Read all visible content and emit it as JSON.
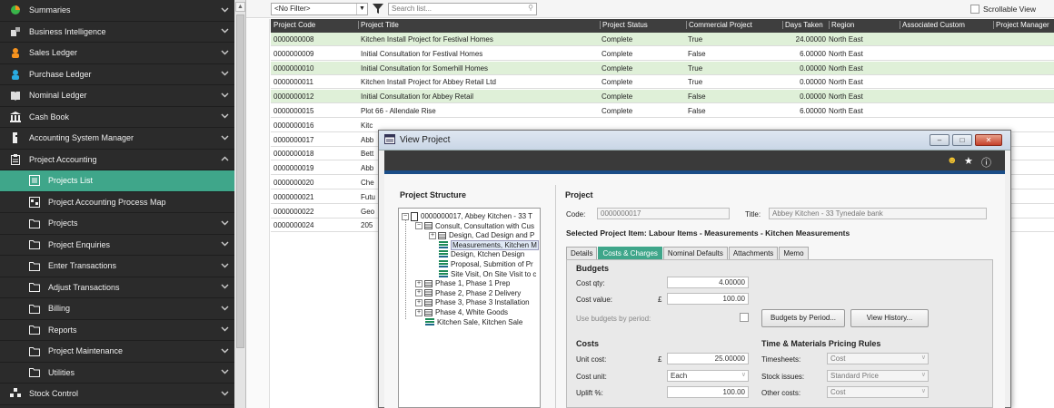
{
  "sidebar": {
    "items": [
      {
        "label": "Summaries",
        "icon": "pie-chart-icon",
        "chev": "down"
      },
      {
        "label": "Business Intelligence",
        "icon": "bi-icon",
        "chev": "down"
      },
      {
        "label": "Sales Ledger",
        "icon": "person-orange-icon",
        "chev": "down"
      },
      {
        "label": "Purchase Ledger",
        "icon": "person-blue-icon",
        "chev": "down"
      },
      {
        "label": "Nominal Ledger",
        "icon": "book-icon",
        "chev": "down"
      },
      {
        "label": "Cash Book",
        "icon": "bank-icon",
        "chev": "down"
      },
      {
        "label": "Accounting System Manager",
        "icon": "manager-icon",
        "chev": "down"
      },
      {
        "label": "Project Accounting",
        "icon": "clipboard-icon",
        "chev": "up"
      },
      {
        "label": "Projects List",
        "icon": "list-icon",
        "sub": true,
        "active": true
      },
      {
        "label": "Project Accounting Process Map",
        "icon": "process-map-icon",
        "sub": true
      },
      {
        "label": "Projects",
        "icon": "folder-icon",
        "sub": true,
        "chev": "down"
      },
      {
        "label": "Project Enquiries",
        "icon": "folder-icon",
        "sub": true,
        "chev": "down"
      },
      {
        "label": "Enter Transactions",
        "icon": "folder-icon",
        "sub": true,
        "chev": "down"
      },
      {
        "label": "Adjust Transactions",
        "icon": "folder-icon",
        "sub": true,
        "chev": "down"
      },
      {
        "label": "Billing",
        "icon": "folder-icon",
        "sub": true,
        "chev": "down"
      },
      {
        "label": "Reports",
        "icon": "folder-icon",
        "sub": true,
        "chev": "down"
      },
      {
        "label": "Project Maintenance",
        "icon": "folder-icon",
        "sub": true,
        "chev": "down"
      },
      {
        "label": "Utilities",
        "icon": "folder-icon",
        "sub": true,
        "chev": "down"
      },
      {
        "label": "Stock Control",
        "icon": "stock-icon",
        "chev": "down"
      }
    ]
  },
  "toolbar": {
    "filter_value": "<No Filter>",
    "search_placeholder": "Search list...",
    "scrollable_view": "Scrollable View"
  },
  "grid": {
    "columns": [
      "Project Code",
      "Project Title",
      "Project Status",
      "Commercial Project",
      "Days Taken",
      "Region",
      "Associated Custom",
      "Project Manager"
    ],
    "rows": [
      {
        "code": "0000000008",
        "title": "Kitchen Install Project for Festival Homes",
        "status": "Complete",
        "commercial": "True",
        "days": "24.00000",
        "region": "North East"
      },
      {
        "code": "0000000009",
        "title": "Initial Consultation for Festival Homes",
        "status": "Complete",
        "commercial": "False",
        "days": "6.00000",
        "region": "North East"
      },
      {
        "code": "0000000010",
        "title": "Initial Consultation for Somerhill Homes",
        "status": "Complete",
        "commercial": "True",
        "days": "0.00000",
        "region": "North East"
      },
      {
        "code": "0000000011",
        "title": "Kitchen Install Project for Abbey Retail Ltd",
        "status": "Complete",
        "commercial": "True",
        "days": "0.00000",
        "region": "North East"
      },
      {
        "code": "0000000012",
        "title": "Initial Consultation for Abbey Retail",
        "status": "Complete",
        "commercial": "False",
        "days": "0.00000",
        "region": "North East"
      },
      {
        "code": "0000000015",
        "title": "Plot 66 - Allendale Rise",
        "status": "Complete",
        "commercial": "False",
        "days": "6.00000",
        "region": "North East"
      },
      {
        "code": "0000000016",
        "title": "Kitc",
        "status": "",
        "commercial": "",
        "days": "",
        "region": ""
      },
      {
        "code": "0000000017",
        "title": "Abb",
        "status": "",
        "commercial": "",
        "days": "",
        "region": ""
      },
      {
        "code": "0000000018",
        "title": "Bett",
        "status": "",
        "commercial": "",
        "days": "",
        "region": ""
      },
      {
        "code": "0000000019",
        "title": "Abb",
        "status": "",
        "commercial": "",
        "days": "",
        "region": ""
      },
      {
        "code": "0000000020",
        "title": "Che",
        "status": "",
        "commercial": "",
        "days": "",
        "region": ""
      },
      {
        "code": "0000000021",
        "title": "Futu",
        "status": "",
        "commercial": "",
        "days": "",
        "region": ""
      },
      {
        "code": "0000000022",
        "title": "Geo",
        "status": "",
        "commercial": "",
        "days": "",
        "region": ""
      },
      {
        "code": "0000000024",
        "title": "205",
        "status": "",
        "commercial": "",
        "days": "",
        "region": ""
      }
    ]
  },
  "dialog": {
    "title": "View Project",
    "structure_heading": "Project Structure",
    "project_heading": "Project",
    "code_label": "Code:",
    "code_value": "0000000017",
    "title_label": "Title:",
    "title_value": "Abbey Kitchen - 33 Tynedale bank",
    "selected_item": "Selected Project Item: Labour Items - Measurements - Kitchen Measurements",
    "tree": [
      {
        "label": "0000000017, Abbey Kitchen - 33 T",
        "type": "root"
      },
      {
        "label": "Consult, Consultation with Cus",
        "type": "group"
      },
      {
        "label": "Design, Cad Design and P",
        "type": "group"
      },
      {
        "label": "Measurements, Kitchen M",
        "type": "item",
        "selected": true
      },
      {
        "label": "Design, Ktchen Design",
        "type": "item"
      },
      {
        "label": "Proposal, Submition of Pr",
        "type": "item"
      },
      {
        "label": "Site Visit, On Site Visit to c",
        "type": "item"
      },
      {
        "label": "Phase 1, Phase 1 Prep",
        "type": "group"
      },
      {
        "label": "Phase 2, Phase 2 Delivery",
        "type": "group"
      },
      {
        "label": "Phase 3, Phase 3 Installation",
        "type": "group"
      },
      {
        "label": "Phase 4, White Goods",
        "type": "group"
      },
      {
        "label": "Kitchen Sale, Kitchen Sale",
        "type": "item"
      }
    ],
    "tabs": [
      "Details",
      "Costs & Charges",
      "Nominal Defaults",
      "Attachments",
      "Memo"
    ],
    "active_tab": "Costs & Charges",
    "budgets": {
      "heading": "Budgets",
      "cost_qty_label": "Cost qty:",
      "cost_qty": "4.00000",
      "cost_value_label": "Cost value:",
      "currency": "£",
      "cost_value": "100.00",
      "use_budgets_label": "Use budgets by period:",
      "budgets_by_period_btn": "Budgets by Period...",
      "view_history_btn": "View History..."
    },
    "costs": {
      "heading": "Costs",
      "unit_cost_label": "Unit cost:",
      "unit_cost": "25.00000",
      "cost_unit_label": "Cost unit:",
      "cost_unit": "Each",
      "uplift_label": "Uplift %:",
      "uplift": "100.00"
    },
    "pricing": {
      "heading": "Time & Materials Pricing Rules",
      "timesheets_label": "Timesheets:",
      "timesheets": "Cost",
      "stock_issues_label": "Stock issues:",
      "stock_issues": "Standard Price",
      "other_costs_label": "Other costs:",
      "other_costs": "Cost"
    }
  },
  "colors": {
    "accent": "#3fa68a",
    "sidebar_bg": "#2b2b2b",
    "header_bg": "#3e3e3e",
    "highlight_row": "#dff0d8"
  }
}
